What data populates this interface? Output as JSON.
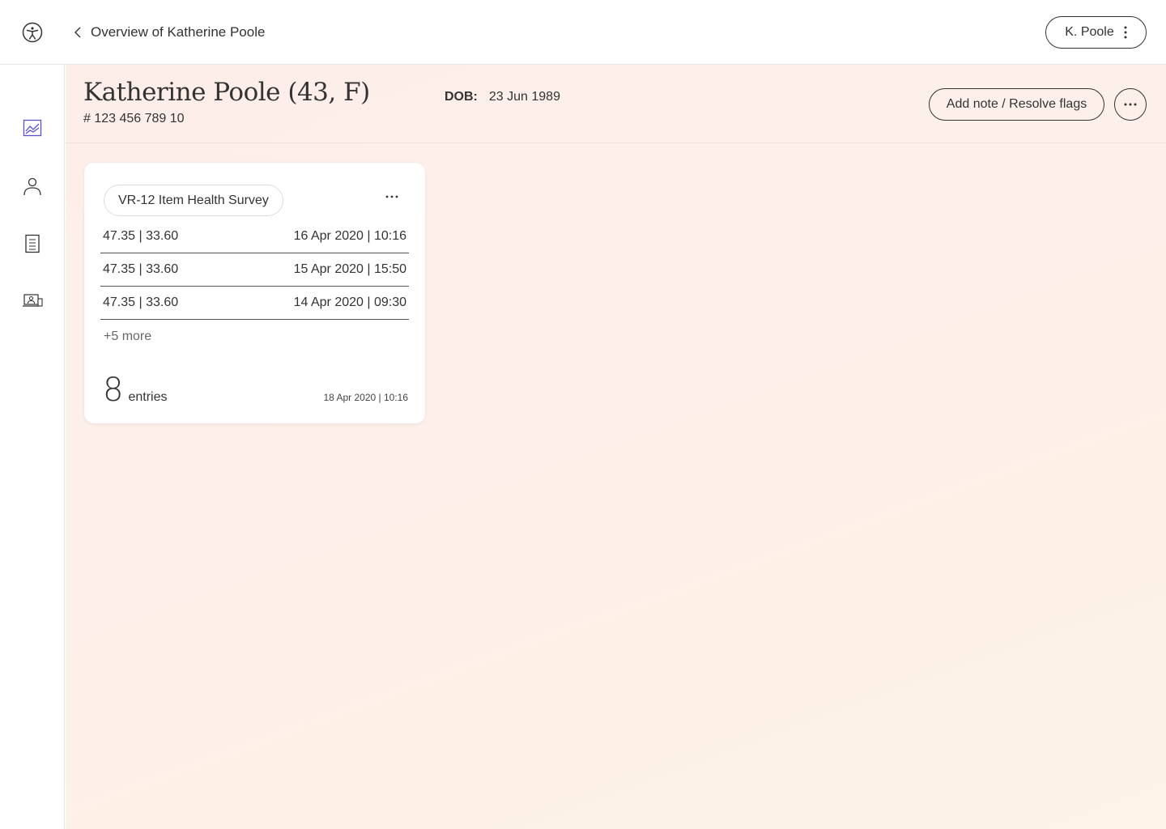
{
  "topbar": {
    "back_label": "Overview of Katherine Poole",
    "user_label": "K. Poole"
  },
  "sidebar": {
    "items": [
      {
        "name": "charts",
        "icon": "chart-icon",
        "active": true
      },
      {
        "name": "profile",
        "icon": "person-icon",
        "active": false
      },
      {
        "name": "documents",
        "icon": "document-icon",
        "active": false
      },
      {
        "name": "devices",
        "icon": "device-user-icon",
        "active": false
      }
    ]
  },
  "patient": {
    "name": "Katherine Poole (43, F)",
    "id": "# 123 456 789 10",
    "dob_label": "DOB:",
    "dob_value": "23 Jun 1989"
  },
  "actions": {
    "note_label": "Add note / Resolve flags"
  },
  "card": {
    "title": "VR-12 Item Health Survey",
    "rows": [
      {
        "value": "47.35 | 33.60",
        "date": "16 Apr 2020 | 10:16"
      },
      {
        "value": "47.35 | 33.60",
        "date": "15 Apr 2020 | 15:50"
      },
      {
        "value": "47.35 | 33.60",
        "date": "14 Apr 2020 | 09:30"
      }
    ],
    "more_label": "+5 more",
    "count": "8",
    "count_label": "entries",
    "last_date": "18 Apr 2020 | 10:16"
  },
  "colors": {
    "accent": "#5b4fd6",
    "text": "#333333",
    "border": "#e6e6e6",
    "bg_gradient_start": "#fdeeea",
    "bg_gradient_end": "#fdf3e8"
  }
}
